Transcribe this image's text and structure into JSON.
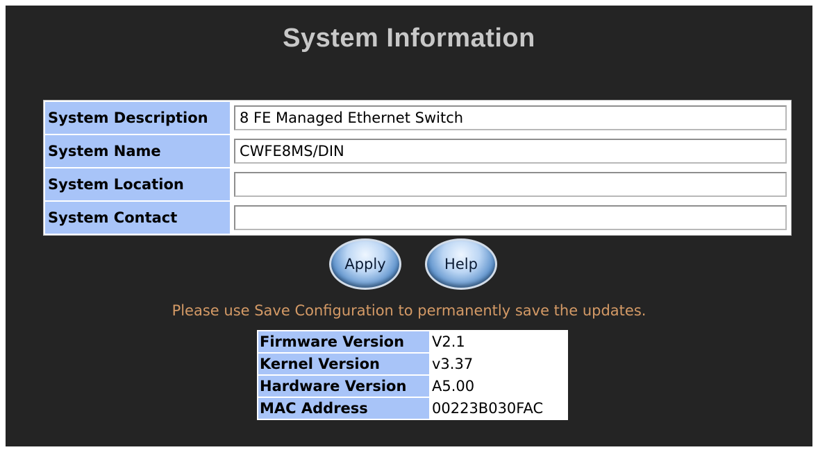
{
  "title": "System Information",
  "system_fields": [
    {
      "label": "System Description",
      "value": "8 FE Managed Ethernet Switch"
    },
    {
      "label": "System Name",
      "value": "CWFE8MS/DIN"
    },
    {
      "label": "System Location",
      "value": ""
    },
    {
      "label": "System Contact",
      "value": ""
    }
  ],
  "buttons": {
    "apply_label": "Apply",
    "help_label": "Help"
  },
  "note": "Please use Save Configuration to permanently save the updates.",
  "versions": [
    {
      "label": "Firmware Version",
      "value": "V2.1"
    },
    {
      "label": "Kernel Version",
      "value": "v3.37"
    },
    {
      "label": "Hardware Version",
      "value": "A5.00"
    },
    {
      "label": "MAC Address",
      "value": "00223B030FAC"
    }
  ],
  "colors": {
    "background": "#242424",
    "title": "#c8c8c8",
    "label_cell": "#a8c4f8",
    "note": "#d49a66"
  }
}
